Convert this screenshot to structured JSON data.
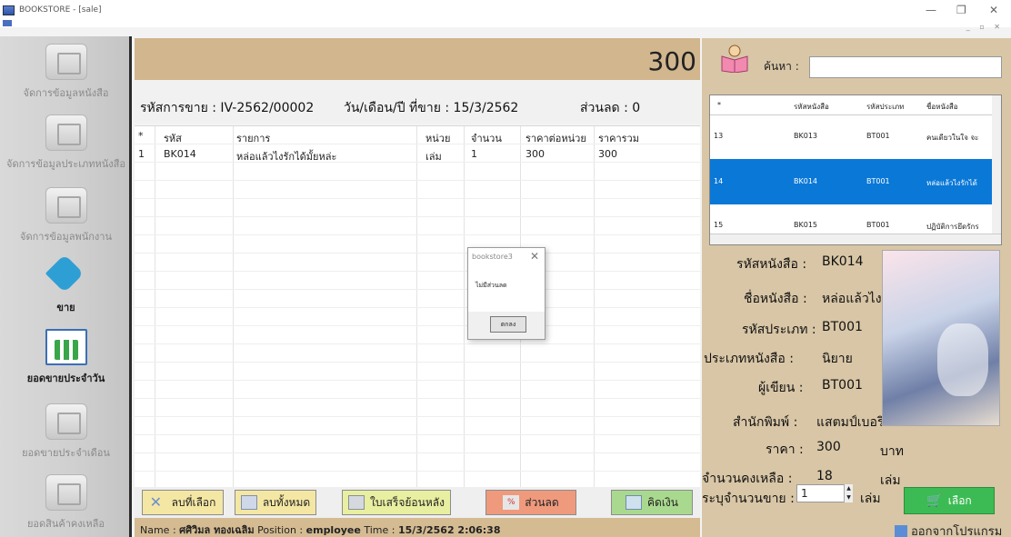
{
  "window": {
    "title": "BOOKSTORE - [sale]"
  },
  "sidebar": {
    "items": [
      {
        "label": "จัดการข้อมูลหนังสือ"
      },
      {
        "label": "จัดการข้อมูลประเภทหนังสือ"
      },
      {
        "label": "จัดการข้อมูลพนักงาน"
      },
      {
        "label": "ขาย"
      },
      {
        "label": "ยอดขายประจำวัน"
      },
      {
        "label": "ยอดขายประจำเดือน"
      },
      {
        "label": "ยอดสินค้าคงเหลือ"
      }
    ]
  },
  "sale": {
    "total": "300",
    "sale_id_label": "รหัสการขาย : IV-2562/00002",
    "date_label": "วัน/เดือน/ปี ที่ขาย : 15/3/2562",
    "discount_label": "ส่วนลด : 0"
  },
  "grid": {
    "headers": [
      "*",
      "รหัส",
      "รายการ",
      "หน่วย",
      "จำนวน",
      "ราคาต่อหน่วย",
      "ราคารวม"
    ],
    "rows": [
      [
        "1",
        "BK014",
        "หล่อแล้วไงรักได้มั้ยหล่ะ",
        "เล่ม",
        "1",
        "300",
        "300"
      ]
    ]
  },
  "buttons": {
    "delete_selected": "ลบที่เลือก",
    "delete_all": "ลบทั้งหมด",
    "receipt_history": "ใบเสร็จย้อนหลัง",
    "discount": "ส่วนลด",
    "checkout": "คิดเงิน"
  },
  "status": {
    "name_label": "Name :",
    "name": "ศศิวิมล ทองเฉลิม",
    "position_label": "Position :",
    "position": "employee",
    "time_label": "Time :",
    "time": "15/3/2562 2:06:38"
  },
  "search": {
    "label": "ค้นหา :",
    "value": ""
  },
  "book_grid": {
    "headers": [
      "*",
      "รหัสหนังสือ",
      "รหัสประเภท",
      "ชื่อหนังสือ"
    ],
    "rows": [
      [
        "13",
        "BK013",
        "BT001",
        "คนเดียวในใจ จะ"
      ],
      [
        "14",
        "BK014",
        "BT001",
        "หล่อแล้วไงรักได้"
      ],
      [
        "15",
        "BK015",
        "BT001",
        "ปฏิบัติการยึดรักร"
      ]
    ],
    "selected_index": 1
  },
  "book_detail": {
    "id_label": "รหัสหนังสือ :",
    "id": "BK014",
    "name_label": "ชื่อหนังสือ :",
    "name": "หล่อแล้วไงรักได้มั้ยหล่ะ",
    "type_label": "รหัสประเภท :",
    "type": "BT001",
    "category_label": "ประเภทหนังสือ :",
    "category": "นิยาย",
    "author_label": "ผู้เขียน :",
    "author": "BT001",
    "publisher_label": "สำนักพิมพ์ :",
    "publisher": "แสตมป์เบอรี่",
    "price_label": "ราคา :",
    "price": "300",
    "price_unit": "บาท",
    "stock_label": "จำนวนคงเหลือ :",
    "stock": "18",
    "stock_unit": "เล่ม",
    "qty_label": "ระบุจำนวนขาย :",
    "qty": "1",
    "qty_unit": "เล่ม"
  },
  "actions": {
    "select": "เลือก",
    "exit": "ออกจากโปรแกรม"
  },
  "dialog": {
    "title": "bookstore3",
    "message": "ไม่มีส่วนลด",
    "ok": "ตกลง"
  },
  "colors": {
    "header": "#d1b68e",
    "right_panel": "#d8c6a6",
    "selected_row": "#0a78d7",
    "select_button": "#3cbb54"
  }
}
